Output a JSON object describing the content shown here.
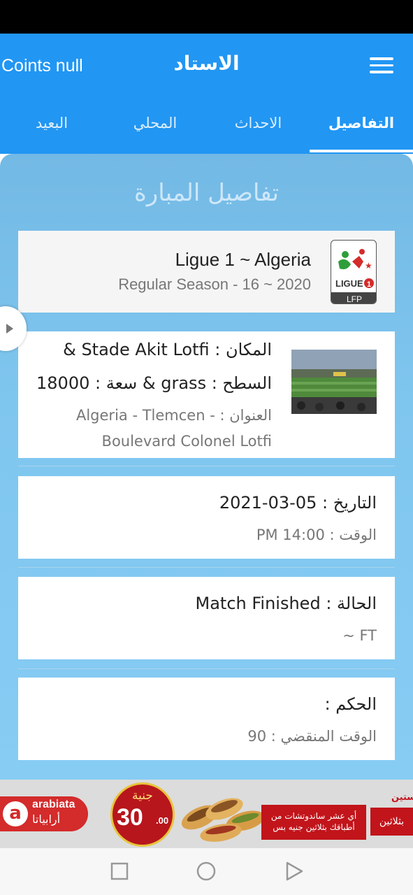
{
  "app_bar": {
    "coins": "Coints null",
    "title": "الاستاد",
    "menu_icon": "hamburger-menu-icon"
  },
  "tabs": [
    {
      "label": "التفاصيل",
      "active": true
    },
    {
      "label": "الاحداث",
      "active": false
    },
    {
      "label": "المحلي",
      "active": false
    },
    {
      "label": "البعيد",
      "active": false
    }
  ],
  "details": {
    "title": "تفاصيل المبارة",
    "league": {
      "name": "Ligue 1 ~ Algeria",
      "season": "Regular Season - 16 ~ 2020",
      "logo_text_top": "LIGUE",
      "logo_text_num": "1",
      "logo_text_bottom": "LFP"
    },
    "venue": {
      "line1": "المكان : Stade Akit Lotfi &",
      "line2": "السطح : grass & سعة : 18000",
      "line3": "العنوان : - Algeria - Tlemcen",
      "line4": "Boulevard Colonel Lotfi"
    },
    "date": {
      "date_line": "التاريخ : 05-03-2021",
      "time_line": "الوقت : 14:00 PM"
    },
    "status": {
      "status_line": "الحالة : Match Finished",
      "short_line": "~ FT"
    },
    "referee": {
      "referee_line": "الحكم :",
      "elapsed_line": "الوقت المنقضي : 90"
    }
  },
  "ad": {
    "brand_latin": "arabiata",
    "brand_arabic": "أرابياتا",
    "brand_initial": "a",
    "price_word": "جنية",
    "price_num": "30",
    "price_dec": ".00",
    "promo_text": "أي عشر ساندوتشات من أطباقك بثلاثين جنيه بس",
    "side_text": "بثلاثين",
    "top_right_text": "ستين"
  },
  "colors": {
    "app_bar": "#2196f3",
    "panel": "#7fc6ef",
    "card": "#ffffff",
    "league_card": "#f5f5f5",
    "ad_red": "#c2141b"
  },
  "nav": {
    "recents_icon": "square-recents-icon",
    "home_icon": "circle-home-icon",
    "back_icon": "triangle-back-icon"
  }
}
